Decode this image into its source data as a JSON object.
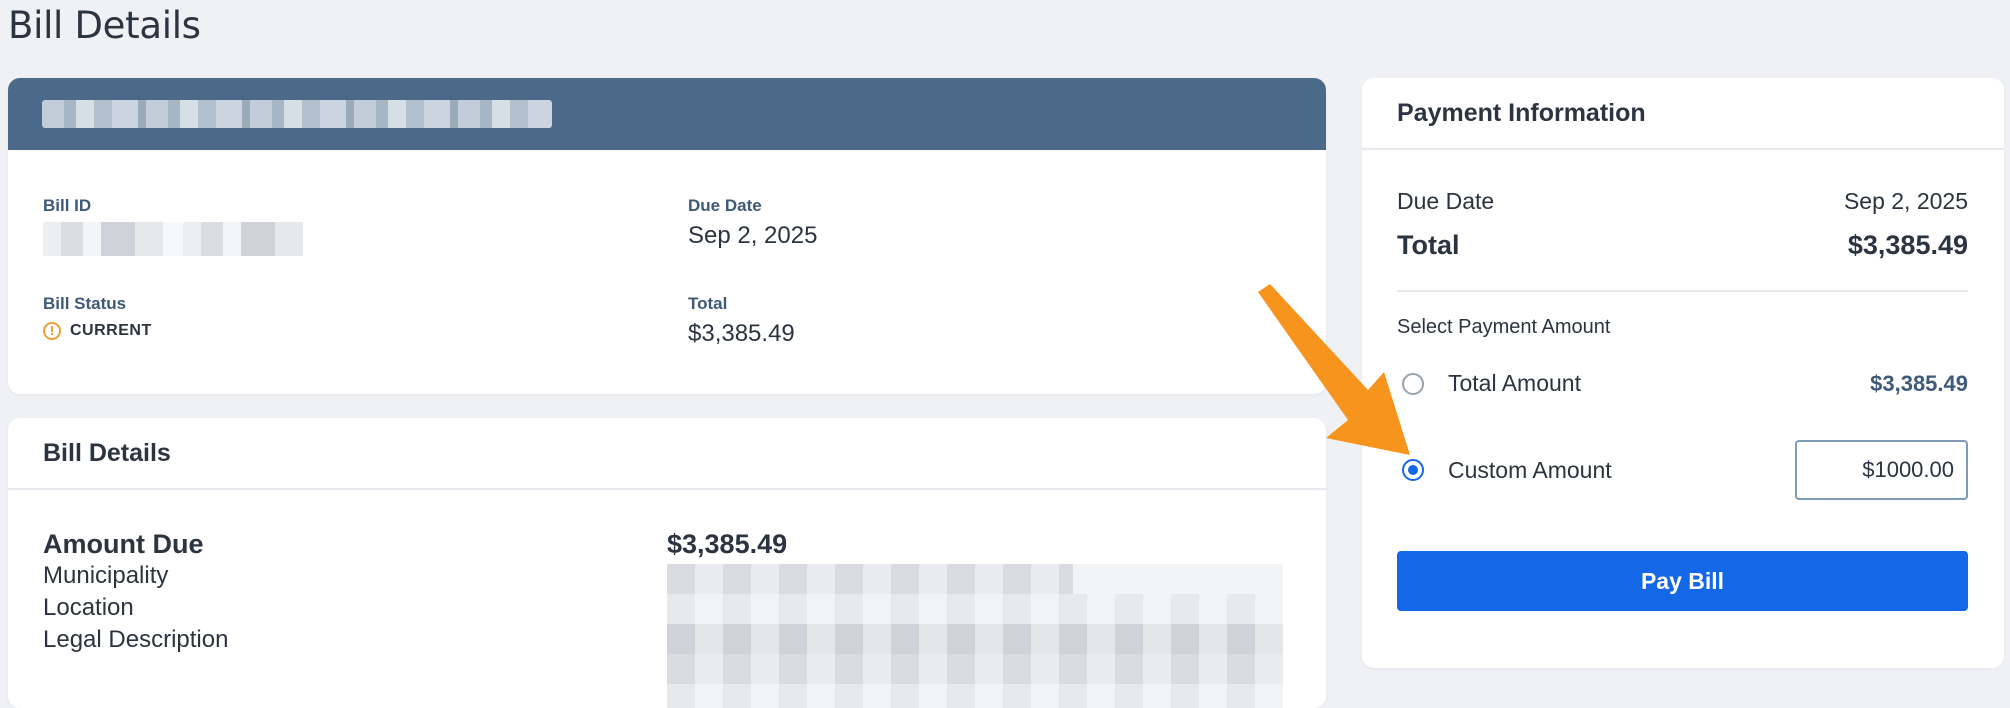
{
  "page": {
    "title": "Bill Details"
  },
  "summary": {
    "bill_id_label": "Bill ID",
    "due_date_label": "Due Date",
    "due_date_value": "Sep 2, 2025",
    "status_label": "Bill Status",
    "status_value": "CURRENT",
    "total_label": "Total",
    "total_value": "$3,385.49"
  },
  "details": {
    "heading": "Bill Details",
    "rows": [
      "Amount Due",
      "Municipality",
      "Location",
      "Legal Description"
    ],
    "amount_due_value": "$3,385.49"
  },
  "payment": {
    "heading": "Payment Information",
    "due_date_label": "Due Date",
    "due_date_value": "Sep 2, 2025",
    "total_label": "Total",
    "total_value": "$3,385.49",
    "select_label": "Select Payment Amount",
    "options": [
      {
        "label": "Total Amount",
        "amount": "$3,385.49",
        "selected": false
      },
      {
        "label": "Custom Amount",
        "selected": true
      }
    ],
    "custom_amount_value": "$1000.00",
    "pay_button_label": "Pay Bill"
  },
  "colors": {
    "header_bar": "#4b6a89",
    "primary": "#1467e6",
    "status_warning": "#e8a23a",
    "annotation_arrow": "#f7941d"
  }
}
